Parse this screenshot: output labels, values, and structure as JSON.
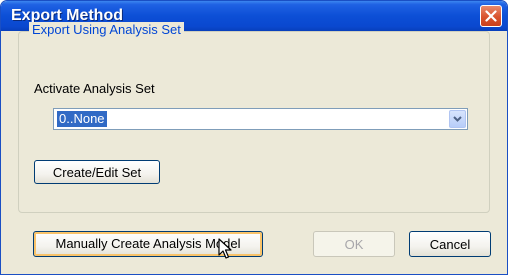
{
  "window": {
    "title": "Export Method"
  },
  "group": {
    "legend": "Export Using Analysis Set",
    "activate_label": "Activate Analysis Set",
    "combo_value": "0..None",
    "create_edit_label": "Create/Edit Set"
  },
  "footer": {
    "manual_label": "Manually Create Analysis Model",
    "ok_label": "OK",
    "cancel_label": "Cancel"
  },
  "colors": {
    "titlebar": "#0c4fd6",
    "close_button": "#d9532d",
    "group_legend": "#0046d5",
    "selection": "#316ac5",
    "dialog_background": "#ece9d8"
  },
  "icons": {
    "close": "close-icon",
    "combo_arrow": "chevron-down-icon",
    "cursor": "mouse-cursor-icon"
  }
}
